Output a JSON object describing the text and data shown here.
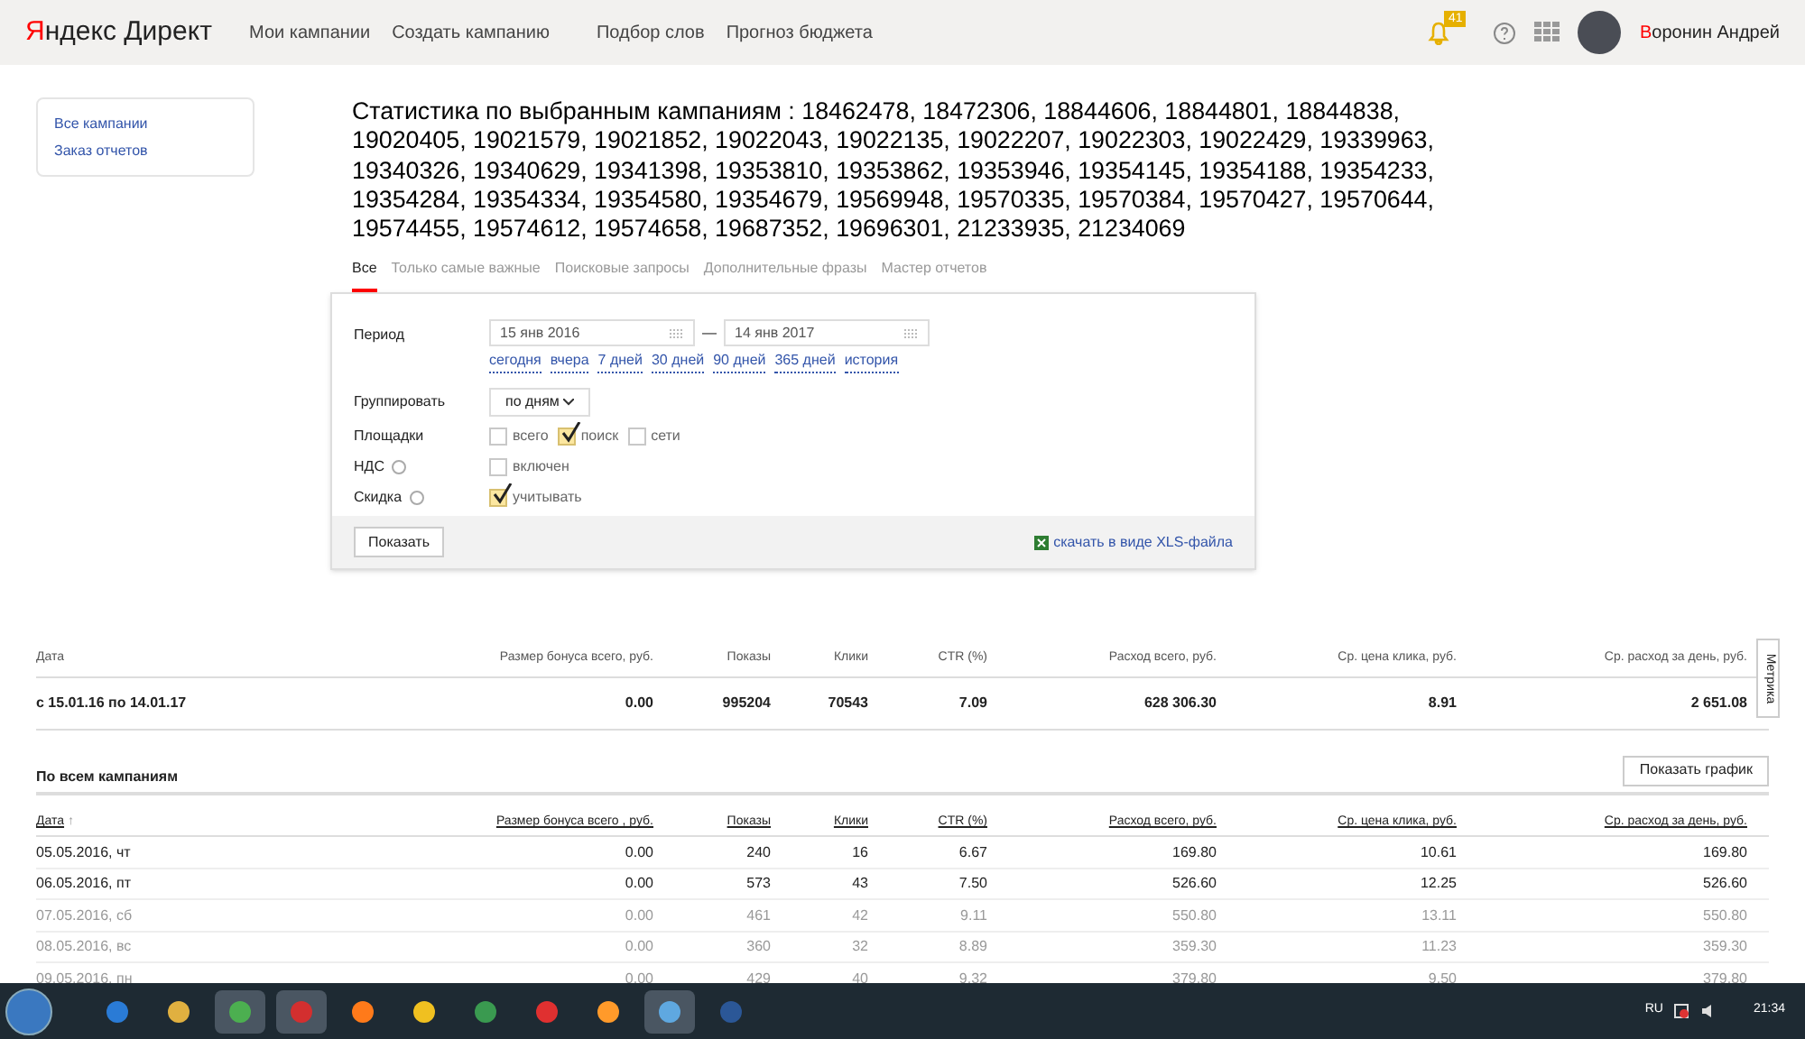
{
  "header": {
    "logo": "Яндекс Директ",
    "nav": [
      "Мои кампании",
      "Создать кампанию",
      "Подбор слов",
      "Прогноз бюджета"
    ],
    "notifications": "41",
    "user": "Воронин Андрей"
  },
  "sidebar": {
    "links": [
      "Все кампании",
      "Заказ отчетов"
    ]
  },
  "title": {
    "label": "Статистика по выбранным кампаниям :",
    "ids": "18462478, 18472306, 18844606, 18844801, 18844838, 19020405, 19021579, 19021852, 19022043, 19022135, 19022207, 19022303, 19022429, 19339963, 19340326, 19340629, 19341398, 19353810, 19353862, 19353946, 19354145, 19354188, 19354233, 19354284, 19354334, 19354580, 19354679, 19569948, 19570335, 19570384, 19570427, 19570644, 19574455, 19574612, 19574658, 19687352, 19696301, 21233935, 21234069"
  },
  "tabs": [
    {
      "label": "Все",
      "selected": true
    },
    {
      "label": "Только самые важные",
      "selected": false
    },
    {
      "label": "Поисковые запросы",
      "selected": false
    },
    {
      "label": "Дополнительные фразы",
      "selected": false
    },
    {
      "label": "Мастер отчетов",
      "selected": false
    }
  ],
  "form": {
    "period_label": "Период",
    "date_from": "15 янв 2016",
    "dash": "—",
    "date_to": "14 янв 2017",
    "quick_ranges": [
      "сегодня",
      "вчера",
      "7 дней",
      "30 дней",
      "90 дней",
      "365 дней",
      "история"
    ],
    "group_label": "Группировать",
    "group_value": "по дням",
    "platforms_label": "Площадки",
    "platforms": [
      {
        "label": "всего",
        "checked": false
      },
      {
        "label": "поиск",
        "checked": true
      },
      {
        "label": "сети",
        "checked": false
      }
    ],
    "vat_label": "НДС",
    "vat": {
      "label": "включен",
      "checked": false
    },
    "discount_label": "Скидка",
    "discount": {
      "label": "учитывать",
      "checked": true
    },
    "show_button": "Показать",
    "download_link": "скачать в виде XLS-файла"
  },
  "summary": {
    "columns": [
      "Дата",
      "Размер бонуса всего, руб.",
      "Показы",
      "Клики",
      "CTR (%)",
      "Расход всего, руб.",
      "Ср. цена клика, руб.",
      "Ср. расход за день, руб."
    ],
    "row": [
      "с 15.01.16 по 14.01.17",
      "0.00",
      "995204",
      "70543",
      "7.09",
      "628 306.30",
      "8.91",
      "2 651.08"
    ],
    "side_tab": "Метрика"
  },
  "campaigns": {
    "title": "По всем кампаниям",
    "chart_button": "Показать график",
    "sort_mark": "↑",
    "columns": [
      "Дата",
      "Размер бонуса всего , руб.",
      "Показы",
      "Клики",
      "CTR (%)",
      "Расход всего, руб.",
      "Ср. цена клика, руб.",
      "Ср. расход за день, руб."
    ],
    "rows": [
      {
        "muted": false,
        "cells": [
          "05.05.2016, чт",
          "0.00",
          "240",
          "16",
          "6.67",
          "169.80",
          "10.61",
          "169.80"
        ]
      },
      {
        "muted": false,
        "cells": [
          "06.05.2016, пт",
          "0.00",
          "573",
          "43",
          "7.50",
          "526.60",
          "12.25",
          "526.60"
        ]
      },
      {
        "muted": true,
        "cells": [
          "07.05.2016, сб",
          "0.00",
          "461",
          "42",
          "9.11",
          "550.80",
          "13.11",
          "550.80"
        ]
      },
      {
        "muted": true,
        "cells": [
          "08.05.2016, вс",
          "0.00",
          "360",
          "32",
          "8.89",
          "359.30",
          "11.23",
          "359.30"
        ]
      },
      {
        "muted": true,
        "cells": [
          "09.05.2016, пн",
          "0.00",
          "429",
          "40",
          "9.32",
          "379.80",
          "9.50",
          "379.80"
        ]
      }
    ]
  },
  "taskbar": {
    "language": "RU",
    "time": "21:34"
  }
}
